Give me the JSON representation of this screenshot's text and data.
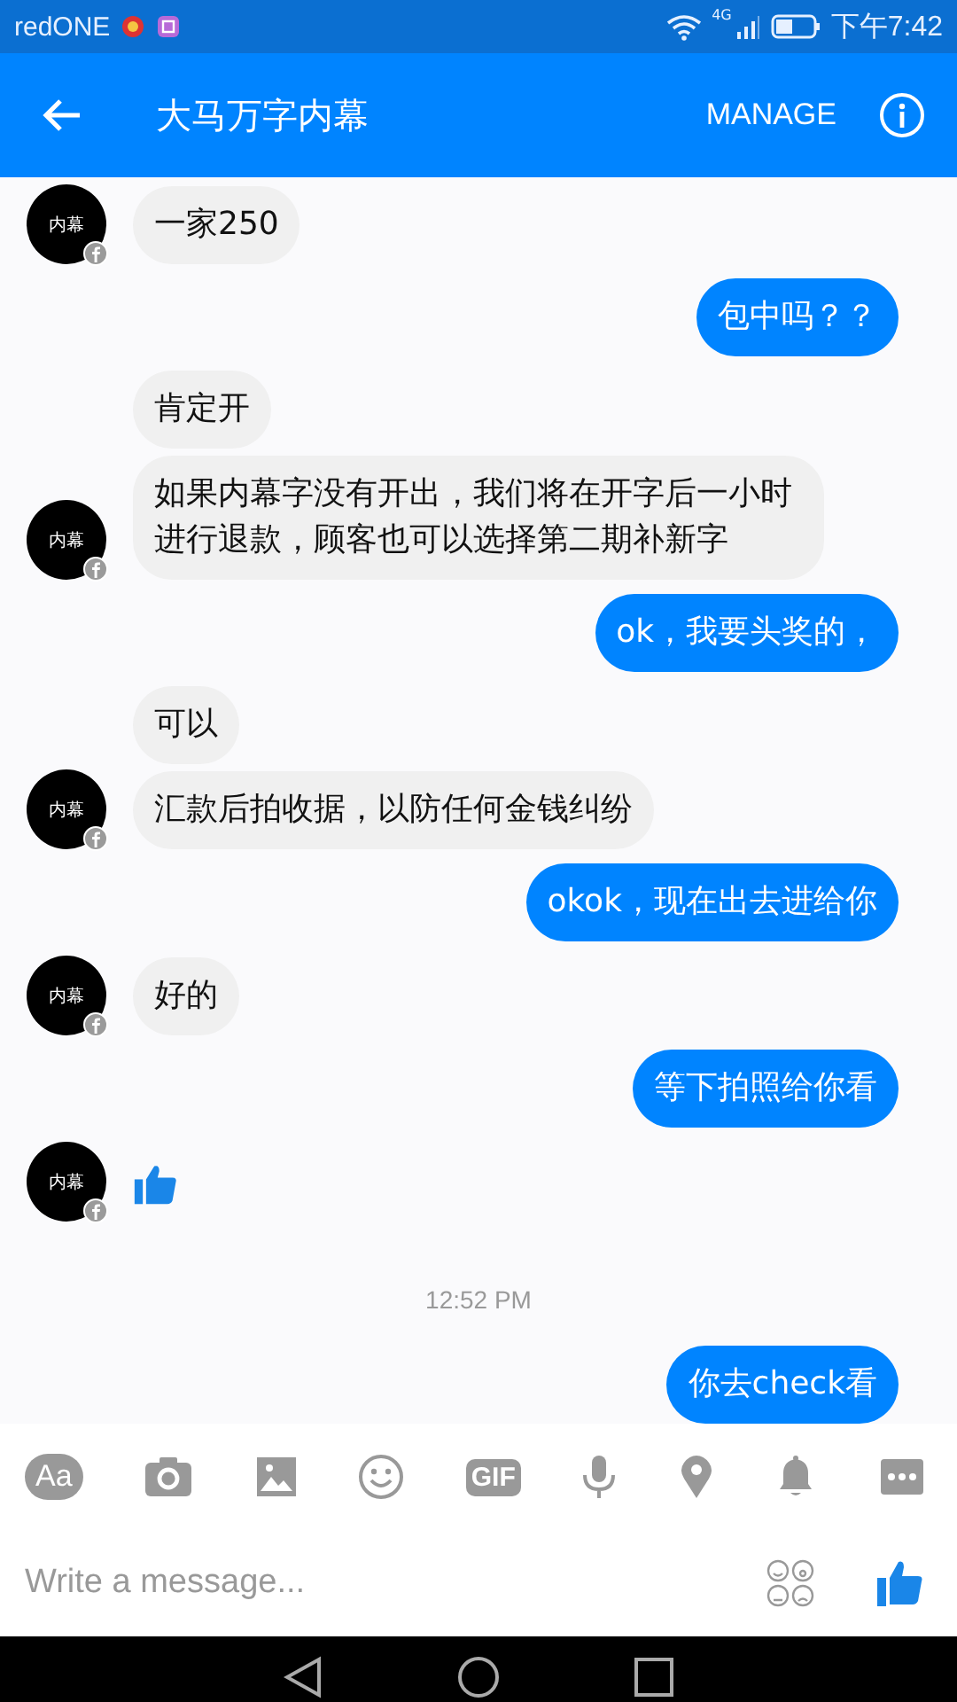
{
  "status_bar": {
    "carrier": "redONE",
    "network": "4G",
    "time": "下午7:42"
  },
  "header": {
    "title": "大马万字内幕",
    "action": "MANAGE"
  },
  "messages": [
    {
      "kind": "group",
      "outgoing": false,
      "avatar_label": "内幕",
      "items": [
        {
          "kind": "text",
          "text": "一家250"
        }
      ]
    },
    {
      "kind": "group",
      "outgoing": true,
      "items": [
        {
          "kind": "text",
          "text": "包中吗？？"
        }
      ]
    },
    {
      "kind": "group",
      "outgoing": false,
      "avatar_label": "内幕",
      "items": [
        {
          "kind": "text",
          "text": "肯定开"
        },
        {
          "kind": "text",
          "text": "如果内幕字没有开出，我们将在开字后一小时进行退款，顾客也可以选择第二期补新字"
        }
      ]
    },
    {
      "kind": "group",
      "outgoing": true,
      "items": [
        {
          "kind": "text",
          "text": "ok，我要头奖的，"
        }
      ]
    },
    {
      "kind": "group",
      "outgoing": false,
      "avatar_label": "内幕",
      "items": [
        {
          "kind": "text",
          "text": "可以"
        },
        {
          "kind": "text",
          "text": "汇款后拍收据，以防任何金钱纠纷"
        }
      ]
    },
    {
      "kind": "group",
      "outgoing": true,
      "items": [
        {
          "kind": "text",
          "text": "okok，现在出去进给你"
        }
      ]
    },
    {
      "kind": "group",
      "outgoing": false,
      "avatar_label": "内幕",
      "items": [
        {
          "kind": "text",
          "text": "好的"
        }
      ]
    },
    {
      "kind": "group",
      "outgoing": true,
      "items": [
        {
          "kind": "text",
          "text": "等下拍照给你看"
        }
      ]
    },
    {
      "kind": "group",
      "outgoing": false,
      "avatar_label": "内幕",
      "items": [
        {
          "kind": "like"
        }
      ]
    },
    {
      "kind": "time",
      "text": "12:52 PM"
    },
    {
      "kind": "group",
      "outgoing": true,
      "items": [
        {
          "kind": "text",
          "text": "你去check看"
        }
      ]
    }
  ],
  "composer": {
    "aa_label": "Aa",
    "gif_label": "GIF",
    "placeholder": "Write a message..."
  }
}
